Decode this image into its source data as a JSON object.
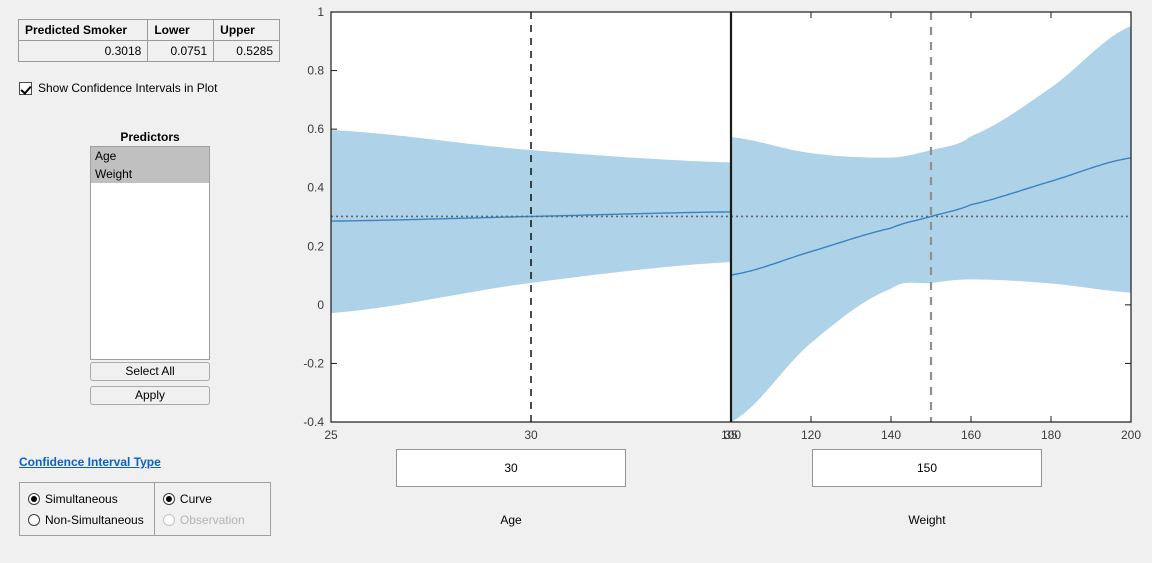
{
  "results_table": {
    "headers": [
      "Predicted Smoker",
      "Lower",
      "Upper"
    ],
    "row": [
      "0.3018",
      "0.0751",
      "0.5285"
    ]
  },
  "show_ci_checkbox": {
    "label": "Show Confidence Intervals in Plot",
    "checked": true
  },
  "predictors": {
    "title": "Predictors",
    "items": [
      {
        "label": "Age",
        "selected": true
      },
      {
        "label": "Weight",
        "selected": true
      }
    ],
    "select_all_label": "Select All",
    "apply_label": "Apply"
  },
  "ci_type": {
    "link_label": "Confidence Interval Type",
    "left_options": [
      {
        "label": "Simultaneous",
        "selected": true,
        "disabled": false
      },
      {
        "label": "Non-Simultaneous",
        "selected": false,
        "disabled": false
      }
    ],
    "right_options": [
      {
        "label": "Curve",
        "selected": true,
        "disabled": false
      },
      {
        "label": "Observation",
        "selected": false,
        "disabled": true
      }
    ]
  },
  "inputs": {
    "age": {
      "value": "30",
      "axis_label": "Age"
    },
    "weight": {
      "value": "150",
      "axis_label": "Weight"
    }
  },
  "colors": {
    "background": "#f0f0f0",
    "band_fill": "#aed2e8",
    "fit_line": "#3b83c0",
    "reference_line": "#5a6670",
    "crosshair_active": "#000000",
    "crosshair_inactive": "#909090",
    "axis": "#1a1a1a",
    "link": "#0b61c7",
    "selection": "#c0c0c0"
  },
  "chart_data": {
    "type": "line",
    "title": "",
    "ylabel": "",
    "ylim": [
      -0.4,
      1
    ],
    "yticks": [
      -0.4,
      -0.2,
      0,
      0.2,
      0.4,
      0.6,
      0.8,
      1
    ],
    "grid": false,
    "reference_value": 0.3018,
    "panels": [
      {
        "name": "Age",
        "xlabel": "Age",
        "xlim": [
          25,
          35
        ],
        "xticks": [
          25,
          30,
          35
        ],
        "xtick_labels": [
          "25",
          "30",
          "35"
        ],
        "current_value": 30,
        "crosshair_active": true,
        "fit": {
          "x": [
            25,
            30,
            35
          ],
          "y": [
            0.286,
            0.3018,
            0.3175
          ]
        },
        "lower": {
          "x": [
            25,
            30,
            35
          ],
          "y": [
            -0.028,
            0.0751,
            0.146
          ]
        },
        "upper": {
          "x": [
            25,
            30,
            35
          ],
          "y": [
            0.597,
            0.5285,
            0.486
          ]
        }
      },
      {
        "name": "Weight",
        "xlabel": "Weight",
        "xlim": [
          100,
          200
        ],
        "xticks": [
          100,
          120,
          140,
          160,
          180,
          200
        ],
        "xtick_labels": [
          "100",
          "120",
          "140",
          "160",
          "180",
          "200"
        ],
        "current_value": 150,
        "crosshair_active": false,
        "fit": {
          "x": [
            100,
            120,
            140,
            150,
            160,
            180,
            200
          ],
          "y": [
            0.102,
            0.182,
            0.262,
            0.3018,
            0.342,
            0.422,
            0.502
          ]
        },
        "lower": {
          "x": [
            100,
            120,
            140,
            150,
            160,
            180,
            200
          ],
          "y": [
            -0.4,
            -0.13,
            0.055,
            0.0751,
            0.087,
            0.073,
            0.042
          ]
        },
        "upper": {
          "x": [
            100,
            120,
            140,
            150,
            160,
            180,
            200
          ],
          "y": [
            0.573,
            0.518,
            0.503,
            0.5285,
            0.576,
            0.742,
            0.952
          ]
        }
      }
    ]
  }
}
